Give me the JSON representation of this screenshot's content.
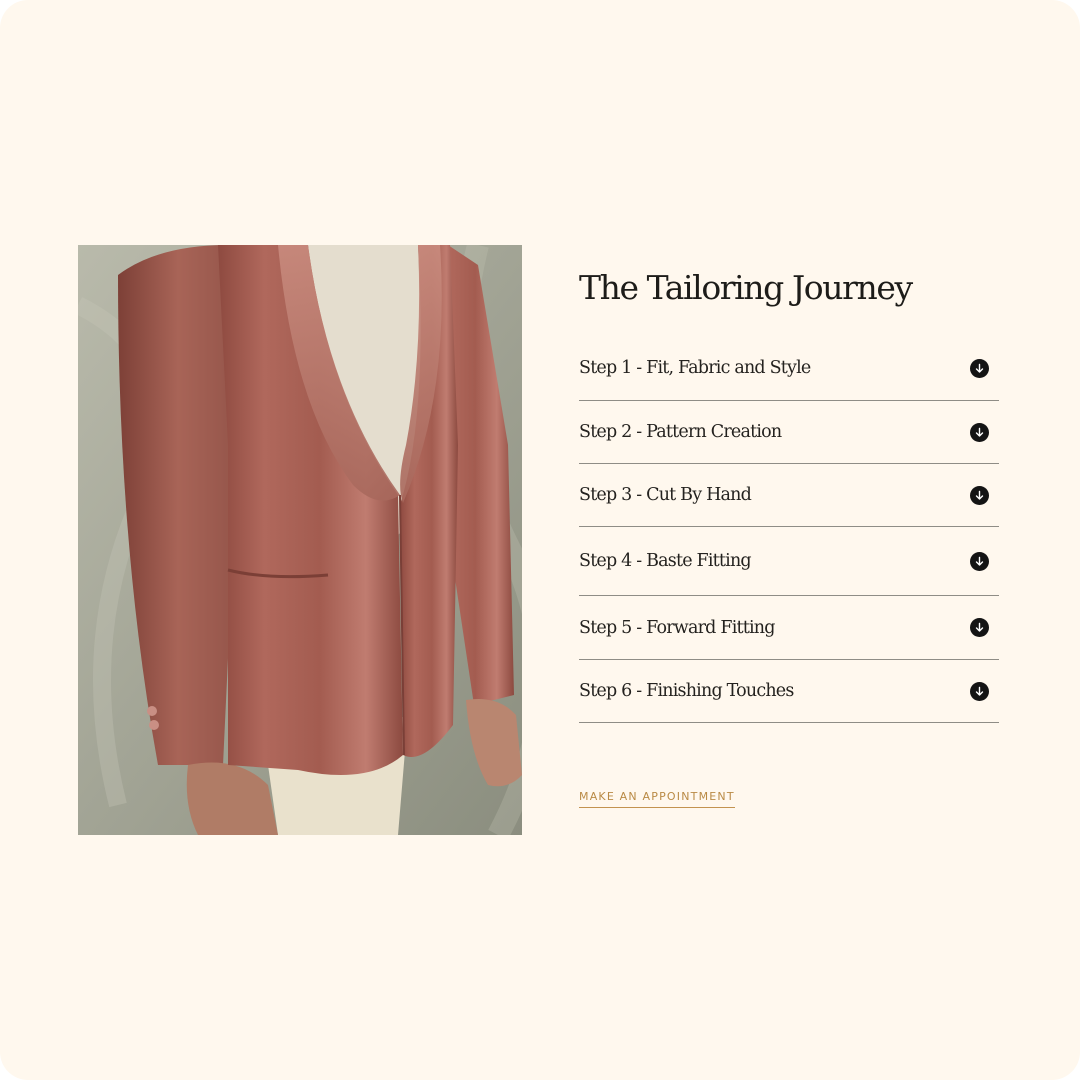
{
  "colors": {
    "background": "#fff8ee",
    "text": "#1d1c19",
    "divider": "#8f8d86",
    "accent": "#b98a45",
    "icon_bg": "#141414"
  },
  "hero_image": {
    "subject": "man wearing a dusty-rose velvet shawl-collar jacket over a cream knit and cream trousers"
  },
  "section": {
    "title": "The Tailoring  Journey"
  },
  "steps": [
    {
      "label": "Step 1 - Fit, Fabric and Style",
      "icon": "arrow-down-circle-icon"
    },
    {
      "label": "Step 2 - Pattern Creation",
      "icon": "arrow-down-circle-icon"
    },
    {
      "label": "Step 3 - Cut By Hand",
      "icon": "arrow-down-circle-icon"
    },
    {
      "label": "Step 4 - Baste Fitting",
      "icon": "arrow-down-circle-icon"
    },
    {
      "label": "Step 5 - Forward Fitting",
      "icon": "arrow-down-circle-icon"
    },
    {
      "label": "Step 6 - Finishing Touches",
      "icon": "arrow-down-circle-icon"
    }
  ],
  "cta": {
    "label": "MAKE AN APPOINTMENT"
  }
}
